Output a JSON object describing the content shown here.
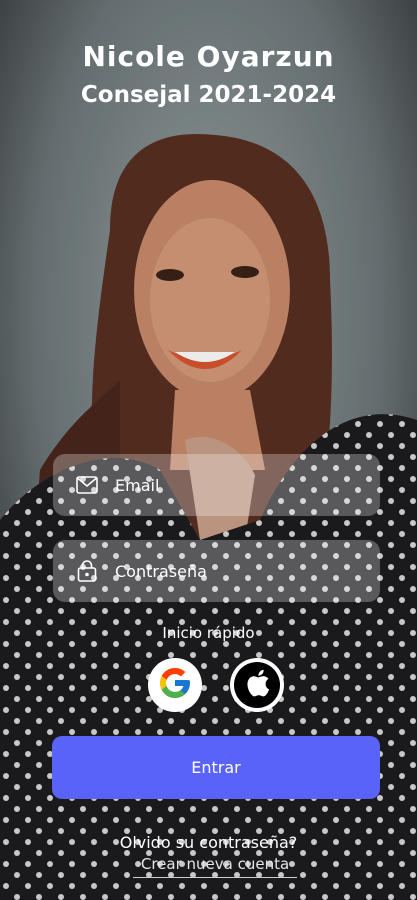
{
  "header": {
    "name": "Nicole Oyarzun",
    "role": "Consejal 2021-2024"
  },
  "form": {
    "email_placeholder": "Email",
    "password_placeholder": "Contraseña"
  },
  "quick_login": {
    "label": "Inicio rápido",
    "providers": [
      "google-icon",
      "apple-icon"
    ]
  },
  "actions": {
    "submit_label": "Entrar",
    "forgot_password": "Olvido su contraseña?",
    "create_account": "Crear nueva cuenta"
  },
  "colors": {
    "primary_button": "#5a63f8",
    "field_bg": "rgba(255,255,255,0.28)"
  }
}
